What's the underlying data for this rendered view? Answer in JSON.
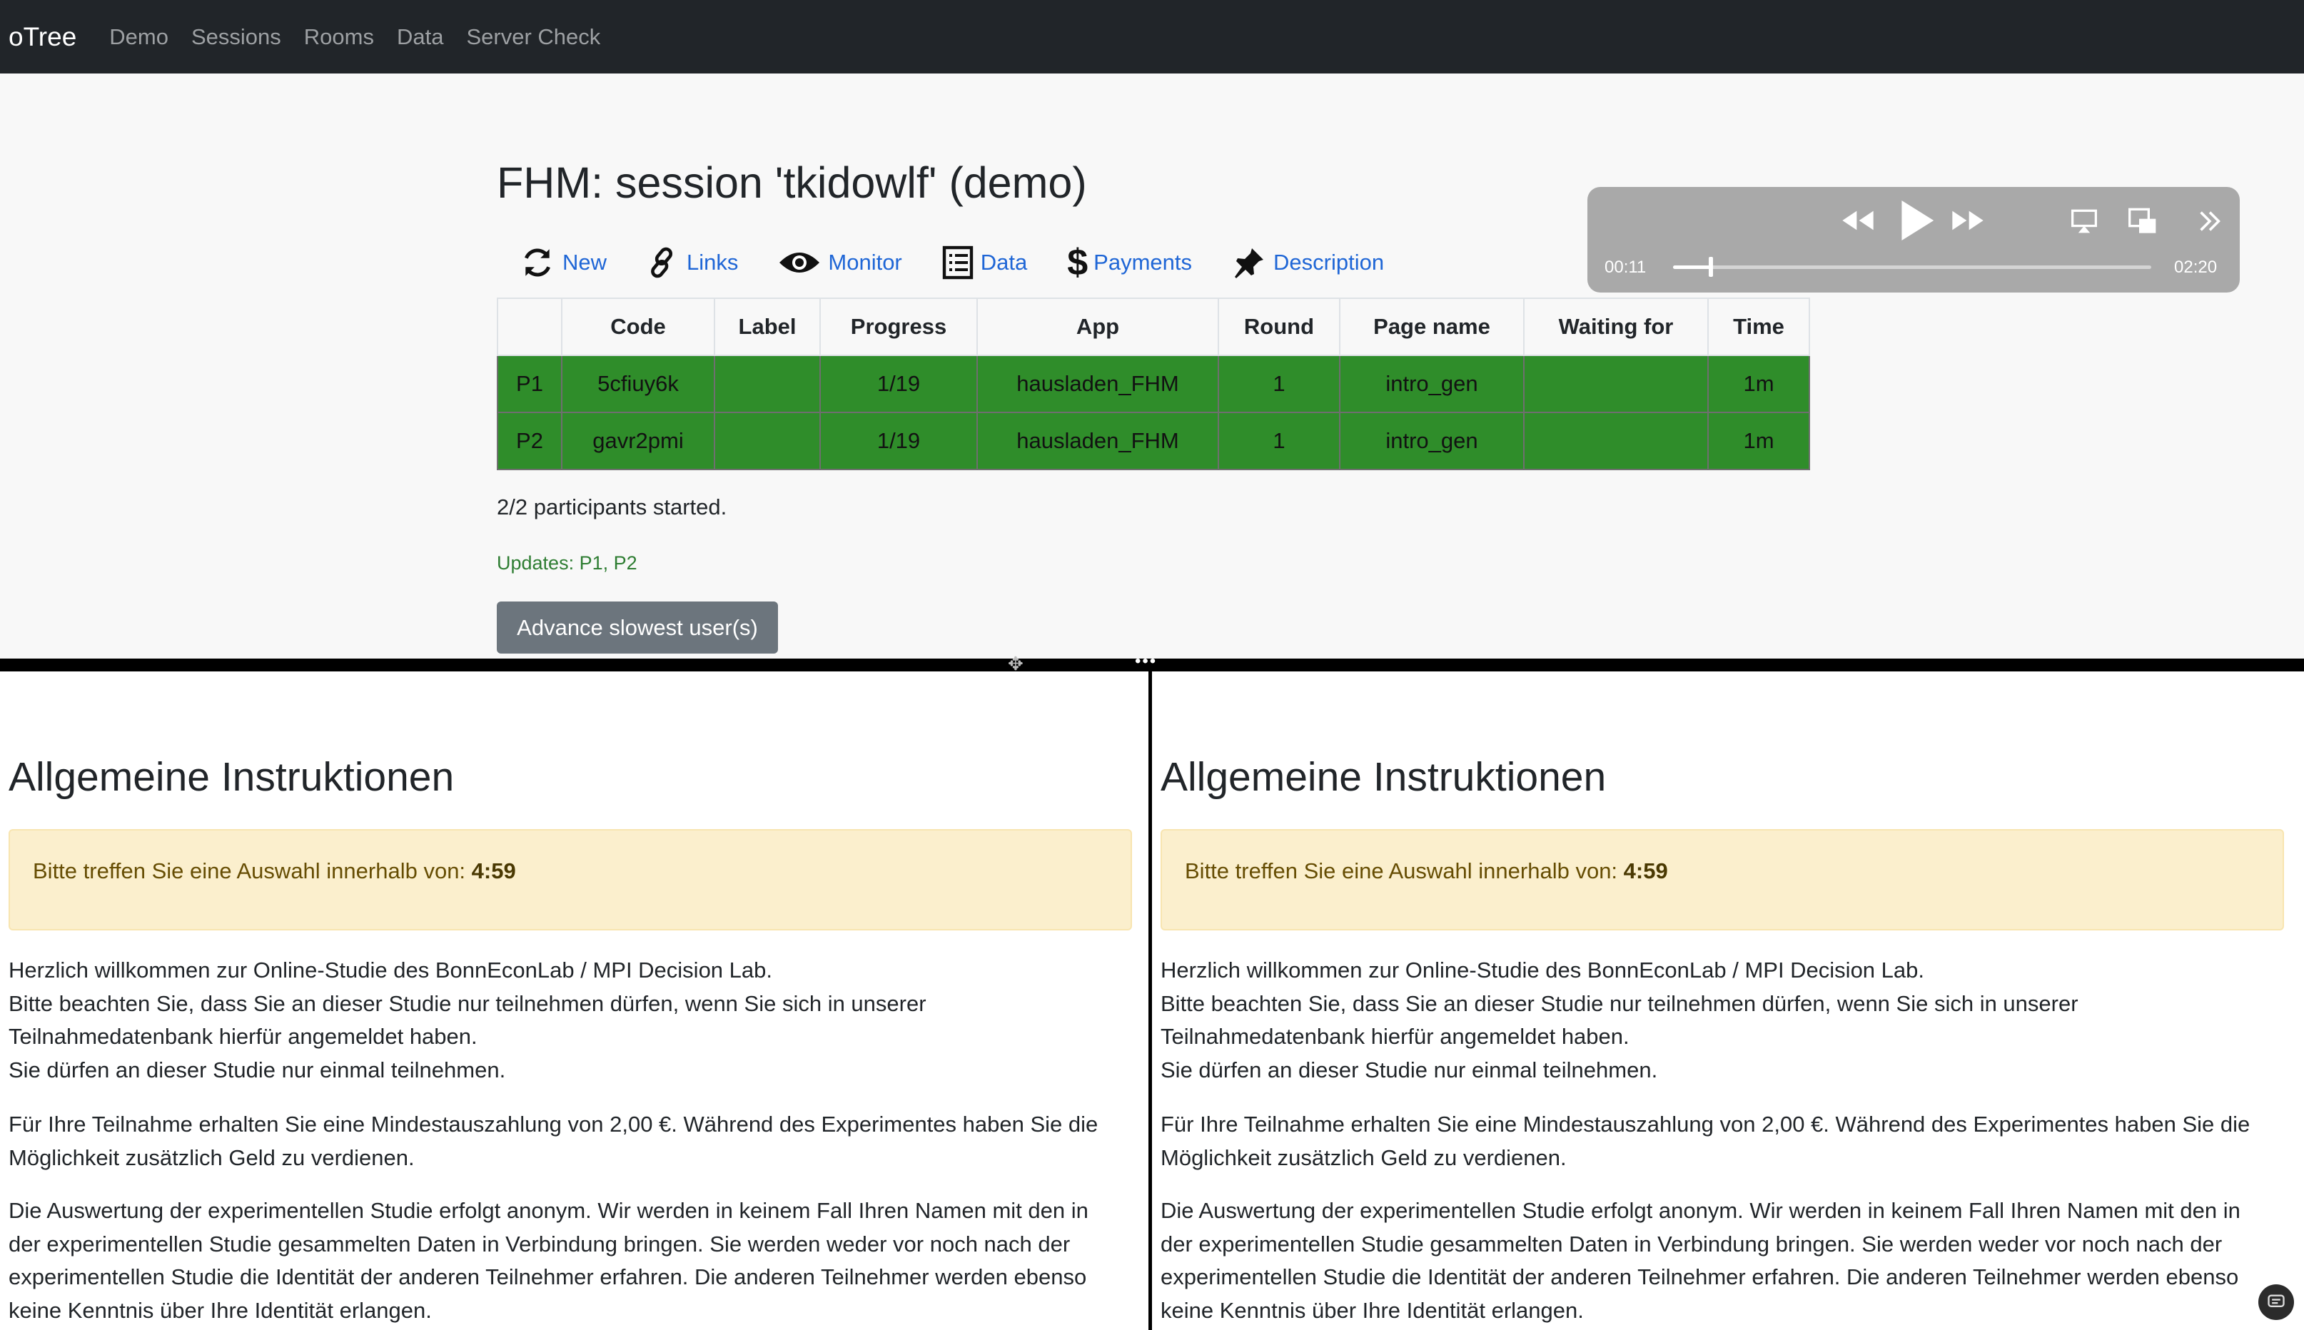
{
  "navbar": {
    "brand": "oTree",
    "links": [
      "Demo",
      "Sessions",
      "Rooms",
      "Data",
      "Server Check"
    ]
  },
  "page": {
    "title": "FHM: session 'tkidowlf' (demo)"
  },
  "tabs": [
    {
      "label": "New",
      "icon": "refresh-icon"
    },
    {
      "label": "Links",
      "icon": "link-icon"
    },
    {
      "label": "Monitor",
      "icon": "eye-icon"
    },
    {
      "label": "Data",
      "icon": "table-icon"
    },
    {
      "label": "Payments",
      "icon": "dollar-icon"
    },
    {
      "label": "Description",
      "icon": "pin-icon"
    }
  ],
  "table": {
    "headers": [
      "",
      "Code",
      "Label",
      "Progress",
      "App",
      "Round",
      "Page name",
      "Waiting for",
      "Time"
    ],
    "rows": [
      [
        "P1",
        "5cfiuy6k",
        "",
        "1/19",
        "hausladen_FHM",
        "1",
        "intro_gen",
        "",
        "1m"
      ],
      [
        "P2",
        "gavr2pmi",
        "",
        "1/19",
        "hausladen_FHM",
        "1",
        "intro_gen",
        "",
        "1m"
      ]
    ],
    "row_color": "#2f8d2a"
  },
  "status": {
    "started": "2/2 participants started.",
    "updates": "Updates: P1, P2"
  },
  "advance_button": "Advance slowest user(s)",
  "player": {
    "current_time": "00:11",
    "duration": "02:20",
    "progress": 0.079
  },
  "panes": {
    "left": {
      "heading": "Allgemeine Instruktionen",
      "timer_label": "Bitte treffen Sie eine Auswahl innerhalb von:",
      "timer_value": "4:59",
      "p1": [
        "Herzlich willkommen zur Online-Studie des BonnEconLab / MPI Decision Lab.",
        "Bitte beachten Sie, dass Sie an dieser Studie nur teilnehmen dürfen, wenn Sie sich in unserer",
        "Teilnahmedatenbank hierfür angemeldet haben.",
        "Sie dürfen an dieser Studie nur einmal teilnehmen."
      ],
      "p2": [
        "Für Ihre Teilnahme erhalten Sie eine Mindestauszahlung von 2,00 €. Während des Experimentes haben Sie die",
        "Möglichkeit zusätzlich Geld zu verdienen."
      ],
      "p3": [
        "Die Auswertung der experimentellen Studie erfolgt anonym. Wir werden in keinem Fall Ihren Namen mit den in",
        "der experimentellen Studie gesammelten Daten in Verbindung bringen. Sie werden weder vor noch nach der",
        "experimentellen Studie die Identität der anderen Teilnehmer erfahren. Die anderen Teilnehmer werden ebenso",
        "keine Kenntnis über Ihre Identität erlangen."
      ]
    },
    "right": {
      "heading": "Allgemeine Instruktionen",
      "timer_label": "Bitte treffen Sie eine Auswahl innerhalb von:",
      "timer_value": "4:59",
      "p1": [
        "Herzlich willkommen zur Online-Studie des BonnEconLab / MPI Decision Lab.",
        "Bitte beachten Sie, dass Sie an dieser Studie nur teilnehmen dürfen, wenn Sie sich in unserer",
        "Teilnahmedatenbank hierfür angemeldet haben.",
        "Sie dürfen an dieser Studie nur einmal teilnehmen."
      ],
      "p2": [
        "Für Ihre Teilnahme erhalten Sie eine Mindestauszahlung von 2,00 €. Während des Experimentes haben Sie die",
        "Möglichkeit zusätzlich Geld zu verdienen."
      ],
      "p3": [
        "Die Auswertung der experimentellen Studie erfolgt anonym. Wir werden in keinem Fall Ihren Namen mit den in",
        "der experimentellen Studie gesammelten Daten in Verbindung bringen. Sie werden weder vor noch nach der",
        "experimentellen Studie die Identität der anderen Teilnehmer erfahren. Die anderen Teilnehmer werden ebenso",
        "keine Kenntnis über Ihre Identität erlangen."
      ]
    }
  }
}
